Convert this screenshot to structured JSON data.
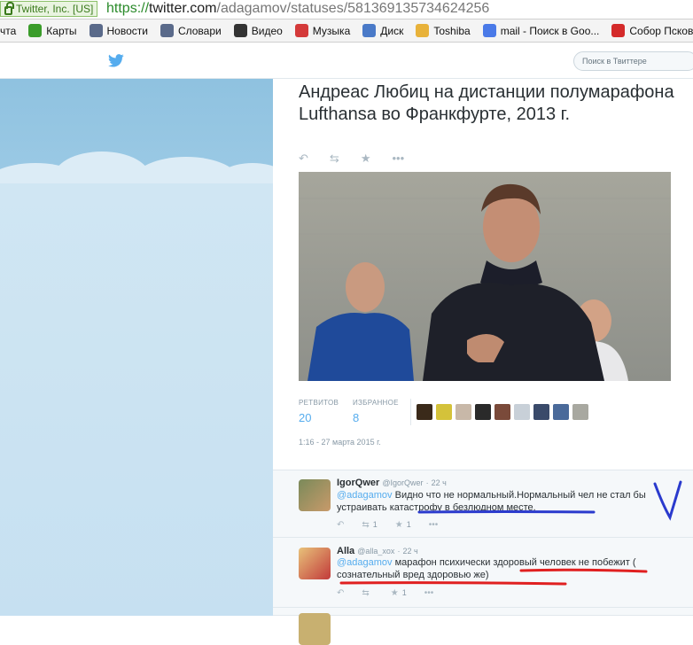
{
  "browser": {
    "cert": "Twitter, Inc. [US]",
    "url_scheme": "https://",
    "url_host": "twitter.com",
    "url_path": "/adagamov/statuses/581369135734624256",
    "bookmarks": [
      {
        "label": "чта",
        "color": "#2a66c8",
        "icon": "mail-icon"
      },
      {
        "label": "Карты",
        "color": "#3a9c2a",
        "icon": "maps-icon"
      },
      {
        "label": "Новости",
        "color": "#5a6a8a",
        "icon": "news-icon"
      },
      {
        "label": "Словари",
        "color": "#5a6a8a",
        "icon": "dictionary-icon"
      },
      {
        "label": "Видео",
        "color": "#333333",
        "icon": "video-icon"
      },
      {
        "label": "Музыка",
        "color": "#d43a3a",
        "icon": "music-icon"
      },
      {
        "label": "Диск",
        "color": "#4a7ac8",
        "icon": "disk-icon"
      },
      {
        "label": "Toshiba",
        "color": "#e8b23a",
        "icon": "folder-icon"
      },
      {
        "label": "mail - Поиск в Goo...",
        "color": "#4a7ae8",
        "icon": "google-icon"
      },
      {
        "label": "Собор Псковс",
        "color": "#d42a2a",
        "icon": "yandex-icon"
      }
    ]
  },
  "header": {
    "search_placeholder": "Поиск в Твиттере"
  },
  "tweet": {
    "text": "Андреас Любиц на дистанции полумарафона Lufthansa во Франкфурте, 2013 г.",
    "retweets_label": "РЕТВИТОВ",
    "retweets": "20",
    "favorites_label": "ИЗБРАННОЕ",
    "favorites": "8",
    "date": "1:16 - 27 марта 2015 г.",
    "favoriter_colors": [
      "#3a2a1a",
      "#d4c23a",
      "#c8b8a8",
      "#2a2a2a",
      "#7a4a3a",
      "#c8d0d8",
      "#3a4a6a",
      "#4a6a9a",
      "#a8a8a0"
    ]
  },
  "replies": [
    {
      "name": "IgorQwer",
      "handle": "@IgorQwer",
      "time": "22 ч",
      "mention": "@adagamov",
      "text": " Видно что не нормальный.Нормальный чел не стал бы устраивать катастрофу в безлюдном месте.",
      "retweets": "1",
      "favorites": "1"
    },
    {
      "name": "Alla",
      "handle": "@alla_xox",
      "time": "22 ч",
      "mention": "@adagamov",
      "text": " марафон психически здоровый человек не побежит ( сознательный вред здоровью же)",
      "retweets": "",
      "favorites": "1"
    }
  ]
}
